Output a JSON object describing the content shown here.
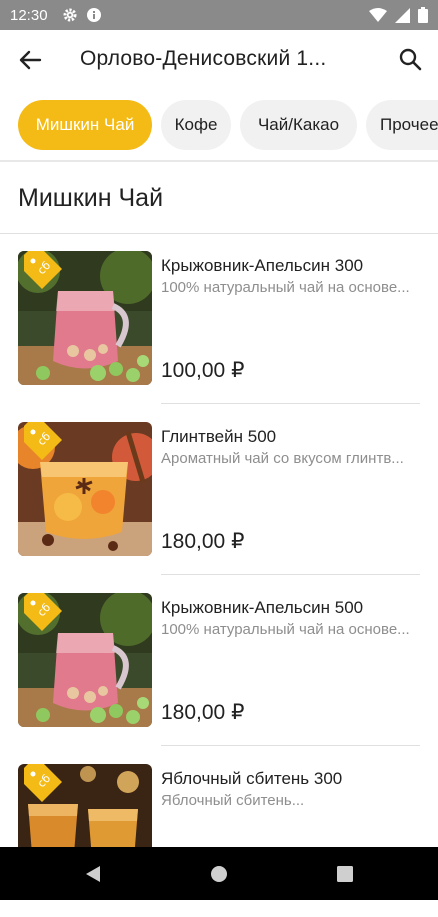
{
  "status_bar": {
    "time": "12:30",
    "icons": [
      "gear-icon",
      "info-icon",
      "wifi-icon",
      "signal-icon",
      "battery-icon"
    ]
  },
  "appbar": {
    "title": "Орлово-Денисовский 1...",
    "back_icon": "arrow-back-icon",
    "search_icon": "search-icon"
  },
  "categories": [
    {
      "label": "Мишкин Чай",
      "active": true
    },
    {
      "label": "Кофе",
      "active": false
    },
    {
      "label": "Чай/Какао",
      "active": false
    },
    {
      "label": "Прочее",
      "active": false
    }
  ],
  "section": {
    "title": "Мишкин Чай"
  },
  "products": [
    {
      "name": "Крыжовник-Апельсин 300",
      "description": "100% натуральный чай на основе...",
      "price": "100,00 ₽",
      "image": "gooseberry-orange-tea",
      "badge_icon": "discount-tag-icon"
    },
    {
      "name": "Глинтвейн 500",
      "description": "Ароматный чай со вкусом глинтв...",
      "price": "180,00 ₽",
      "image": "mulled-wine-tea",
      "badge_icon": "discount-tag-icon"
    },
    {
      "name": "Крыжовник-Апельсин 500",
      "description": "100% натуральный чай на основе...",
      "price": "180,00 ₽",
      "image": "gooseberry-orange-tea",
      "badge_icon": "discount-tag-icon"
    },
    {
      "name": "Яблочный сбитень 300",
      "description": "Яблочный сбитень...",
      "price": "",
      "image": "apple-sbiten",
      "badge_icon": "discount-tag-icon"
    }
  ],
  "nav": {
    "back": "nav-back-icon",
    "home": "nav-home-icon",
    "recents": "nav-recents-icon"
  },
  "colors": {
    "accent": "#f4bb16",
    "status_bar": "#8a8a8a",
    "nav_bar": "#000000"
  }
}
